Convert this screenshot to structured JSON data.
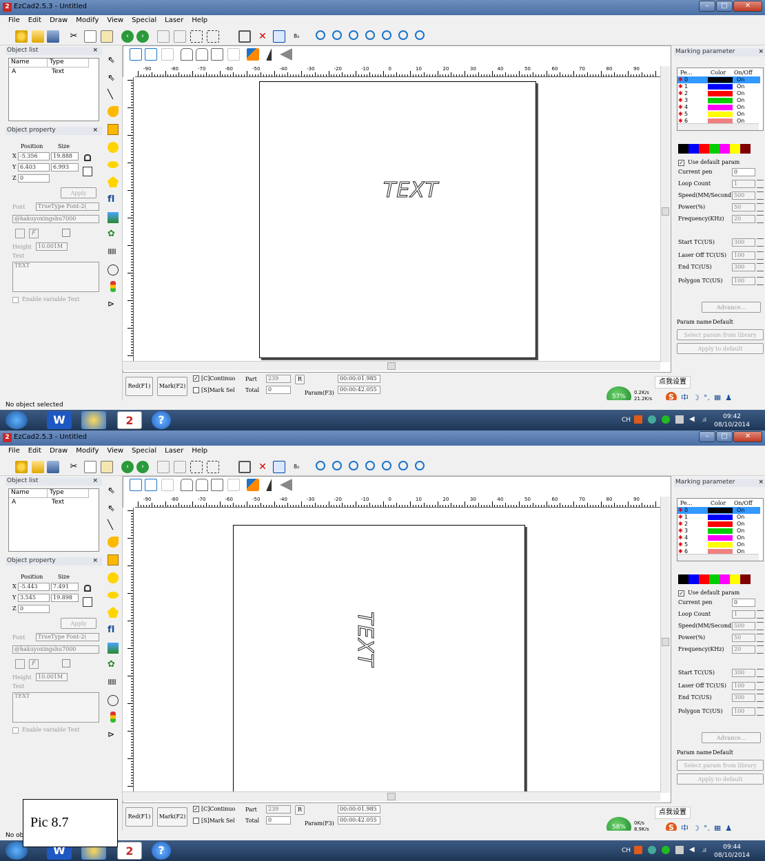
{
  "window_title": "EzCad2.5.3 - Untitled",
  "app_icon_text": "2",
  "menu": [
    "File",
    "Edit",
    "Draw",
    "Modify",
    "View",
    "Special",
    "Laser",
    "Help"
  ],
  "object_list": {
    "title": "Object list",
    "col_name": "Name",
    "col_type": "Type",
    "row_name": "A",
    "row_type": "Text"
  },
  "object_property": {
    "title": "Object property",
    "position_label": "Position",
    "size_label": "Size",
    "x_label": "X",
    "y_label": "Y",
    "z_label": "Z",
    "apply": "Apply",
    "font_label": "Font",
    "font_type": "TrueType Font-2(",
    "font_name": "@hakuyoxingshu7000",
    "height_label": "Height",
    "height_value": "10.001M",
    "text_label": "Text",
    "text_value": "TEXT",
    "enable_variable": "Enable variable Text"
  },
  "marking": {
    "title": "Marking parameter",
    "col_pen": "Pe...",
    "col_color": "Color",
    "col_onoff": "On/Off",
    "pens": [
      {
        "n": "0",
        "color": "#000000",
        "state": "On"
      },
      {
        "n": "1",
        "color": "#0000ff",
        "state": "On"
      },
      {
        "n": "2",
        "color": "#ff0000",
        "state": "On"
      },
      {
        "n": "3",
        "color": "#00cc00",
        "state": "On"
      },
      {
        "n": "4",
        "color": "#ff00ff",
        "state": "On"
      },
      {
        "n": "5",
        "color": "#ffff00",
        "state": "On"
      },
      {
        "n": "6",
        "color": "#f08080",
        "state": "On"
      }
    ],
    "palette": [
      "#000000",
      "#0000ff",
      "#ff0000",
      "#00cc00",
      "#ff00ff",
      "#ffff00",
      "#800000"
    ],
    "use_default": "Use default param",
    "params": [
      {
        "label": "Current pen",
        "value": "0",
        "spin": false,
        "dis": false
      },
      {
        "label": "Loop Count",
        "value": "1",
        "spin": true,
        "dis": true
      },
      {
        "label": "Speed(MM/Second)",
        "value": "500",
        "spin": true,
        "dis": true
      },
      {
        "label": "Power(%)",
        "value": "50",
        "spin": true,
        "dis": true
      },
      {
        "label": "Frequency(KHz)",
        "value": "20",
        "spin": true,
        "dis": true
      },
      {
        "label": "Start TC(US)",
        "value": "300",
        "spin": true,
        "dis": true
      },
      {
        "label": "Laser Off TC(US)",
        "value": "100",
        "spin": true,
        "dis": true
      },
      {
        "label": "End TC(US)",
        "value": "300",
        "spin": true,
        "dis": true
      },
      {
        "label": "Polygon TC(US)",
        "value": "100",
        "spin": true,
        "dis": true
      }
    ],
    "advance": "Advance...",
    "param_name_label": "Param name",
    "param_name_value": "Default",
    "select_from_library": "Select param from library",
    "apply_default": "Apply to default"
  },
  "bottom": {
    "red": "Red(F1)",
    "mark": "Mark(F2)",
    "continuous": "[C]Continuo",
    "mark_sel": "[S]Mark Sel",
    "part": "Part",
    "part_value": "239",
    "total": "Total",
    "total_value": "0",
    "r": "R",
    "param": "Param(F3)",
    "time1": "00:00:01.985",
    "time2": "00:00:42.055"
  },
  "ruler_numbers": [
    "-90",
    "-80",
    "-70",
    "-60",
    "-50",
    "-40",
    "-30",
    "-20",
    "-10",
    "0",
    "10",
    "20",
    "30",
    "40",
    "50",
    "60",
    "70",
    "80",
    "90"
  ],
  "status": "No object selected",
  "ime_label": "点我设置",
  "tray_lang": "CH",
  "sogou_text": "中",
  "canvas_text": "TEXT",
  "shots": [
    {
      "x": "-5.356",
      "y": "6.403",
      "z": "0",
      "w": "19.888",
      "h": "6.993",
      "net_pct": "57%",
      "up": "0.2K/s",
      "down": "21.2K/s",
      "time": "09:42",
      "date": "08/10/2014"
    },
    {
      "x": "-5.443",
      "y": "3.545",
      "z": "0",
      "w": "7.491",
      "h": "19.898",
      "net_pct": "58%",
      "up": "0K/s",
      "down": "8.9K/s",
      "time": "09:44",
      "date": "08/10/2014"
    }
  ],
  "caption": "Pic 8.7"
}
